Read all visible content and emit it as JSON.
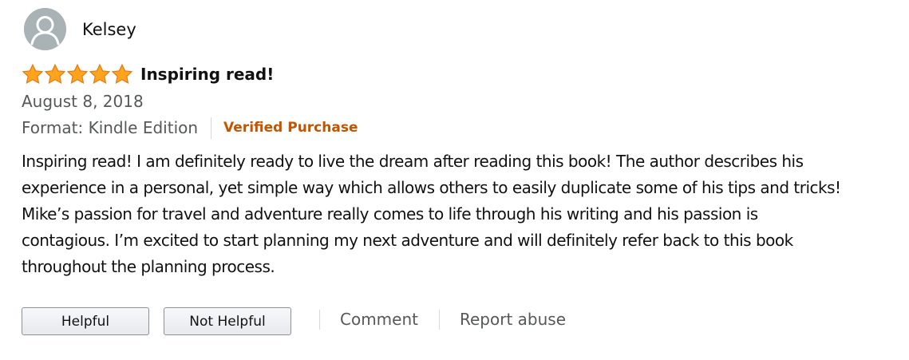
{
  "reviewer": {
    "name": "Kelsey",
    "avatar_icon": "user-avatar-icon"
  },
  "rating": {
    "stars": 5,
    "max_stars": 5,
    "star_color": "#ffa41c"
  },
  "review": {
    "title": "Inspiring read!",
    "date": "August 8, 2018",
    "format": "Format: Kindle Edition",
    "verified_label": "Verified Purchase",
    "verified_color": "#c45500",
    "body_lines": [
      "Inspiring read! I am definitely ready to live the dream after reading this book! The author describes his",
      "experience in a personal, yet simple way which allows others to easily duplicate some of his tips and tricks!",
      "Mike’s passion for travel and adventure really comes to life through his writing and his passion is",
      "contagious. I’m excited to start planning my next adventure and will definitely refer back to this book",
      "throughout the planning process."
    ]
  },
  "actions": {
    "helpful_label": "Helpful",
    "not_helpful_label": "Not Helpful",
    "comment_label": "Comment",
    "report_label": "Report abuse"
  }
}
